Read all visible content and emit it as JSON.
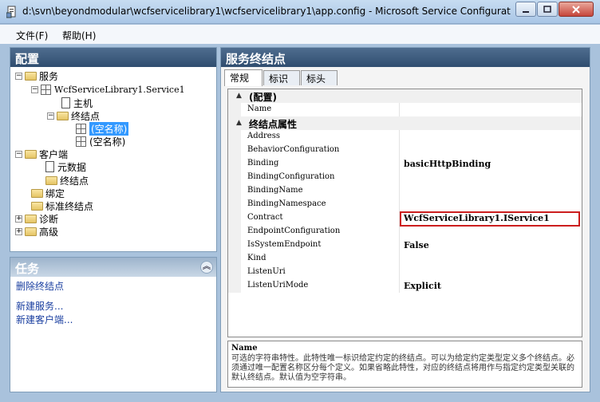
{
  "window": {
    "title": "d:\\svn\\beyondmodular\\wcfservicelibrary1\\wcfservicelibrary1\\app.config - Microsoft Service Configuratio..."
  },
  "menu": {
    "file": "文件(F)",
    "help": "帮助(H)"
  },
  "config_panel": {
    "title": "配置",
    "tree": {
      "services": "服务",
      "service_name": "WcfServiceLibrary1.Service1",
      "host": "主机",
      "endpoints": "终结点",
      "endpoint_1": "(空名称)",
      "endpoint_2": "(空名称)",
      "client": "客户端",
      "metadata": "元数据",
      "client_endpoints": "终结点",
      "bindings": "绑定",
      "standard_endpoints": "标准终结点",
      "diagnostics": "诊断",
      "advanced": "高级"
    }
  },
  "tasks_panel": {
    "title": "任务",
    "items": [
      "删除终结点",
      "新建服务...",
      "新建客户端..."
    ]
  },
  "endpoint_panel": {
    "title": "服务终结点",
    "tabs": [
      "常规",
      "标识",
      "标头"
    ],
    "categories": {
      "config": "(配置)",
      "endpoint_props": "终结点属性"
    },
    "properties": [
      {
        "name": "Name",
        "value": ""
      },
      {
        "name": "Address",
        "value": ""
      },
      {
        "name": "BehaviorConfiguration",
        "value": ""
      },
      {
        "name": "Binding",
        "value": "basicHttpBinding"
      },
      {
        "name": "BindingConfiguration",
        "value": ""
      },
      {
        "name": "BindingName",
        "value": ""
      },
      {
        "name": "BindingNamespace",
        "value": ""
      },
      {
        "name": "Contract",
        "value": "WcfServiceLibrary1.IService1"
      },
      {
        "name": "EndpointConfiguration",
        "value": ""
      },
      {
        "name": "IsSystemEndpoint",
        "value": "False"
      },
      {
        "name": "Kind",
        "value": ""
      },
      {
        "name": "ListenUri",
        "value": ""
      },
      {
        "name": "ListenUriMode",
        "value": "Explicit"
      }
    ],
    "description": {
      "name": "Name",
      "text": "可选的字符串特性。此特性唯一标识给定约定的终结点。可以为给定约定类型定义多个终结点。必须通过唯一配置名称区分每个定义。如果省略此特性，对应的终结点将用作与指定约定类型关联的默认终结点。默认值为空字符串。"
    }
  },
  "colors": {
    "highlight_border": "#cc1e1e",
    "selection": "#3399ff",
    "header_bg": "#2f4d6f"
  }
}
